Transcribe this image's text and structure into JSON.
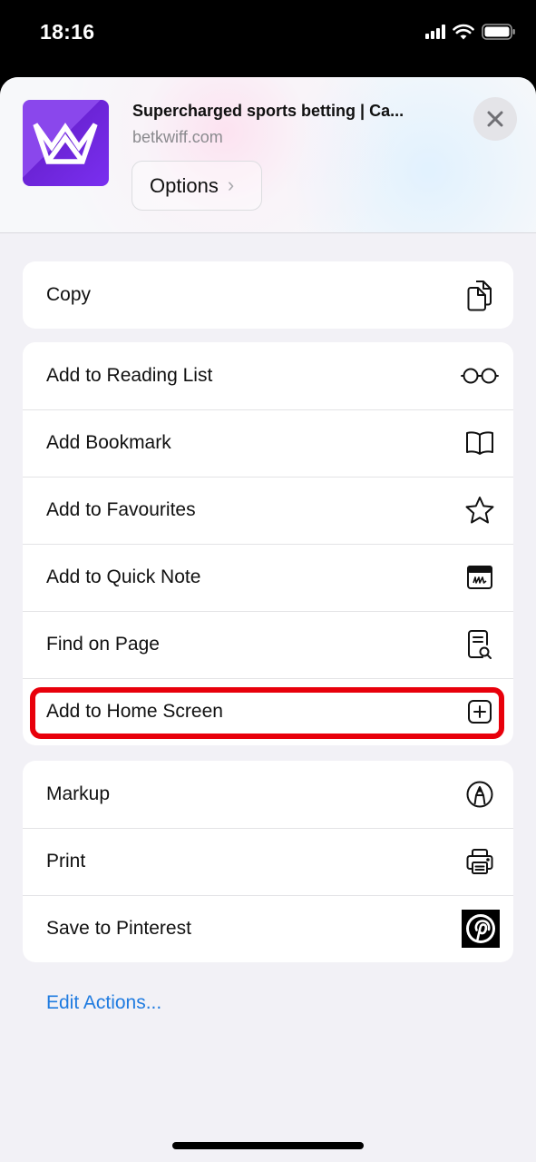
{
  "status_bar": {
    "time": "18:16",
    "icons": [
      "cellular-signal-icon",
      "wifi-icon",
      "battery-icon"
    ]
  },
  "share_header": {
    "title": "Supercharged sports betting | Ca...",
    "domain": "betkwiff.com",
    "options_label": "Options",
    "options_chevron": "›",
    "app_icon": "crown-logo-icon",
    "brand_color": "#7a2ff0",
    "close_icon": "close-icon"
  },
  "groups": [
    {
      "items": [
        {
          "label": "Copy",
          "icon": "copy-icon"
        }
      ]
    },
    {
      "items": [
        {
          "label": "Add to Reading List",
          "icon": "glasses-icon"
        },
        {
          "label": "Add Bookmark",
          "icon": "book-icon"
        },
        {
          "label": "Add to Favourites",
          "icon": "star-icon"
        },
        {
          "label": "Add to Quick Note",
          "icon": "quick-note-icon"
        },
        {
          "label": "Find on Page",
          "icon": "find-on-page-icon"
        },
        {
          "label": "Add to Home Screen",
          "icon": "plus-square-icon",
          "highlighted": true
        }
      ]
    },
    {
      "items": [
        {
          "label": "Markup",
          "icon": "markup-pen-icon"
        },
        {
          "label": "Print",
          "icon": "printer-icon"
        },
        {
          "label": "Save to Pinterest",
          "icon": "pinterest-icon"
        }
      ]
    }
  ],
  "edit_actions_label": "Edit Actions...",
  "colors": {
    "highlight": "#e8000b",
    "link": "#1f7be0"
  }
}
